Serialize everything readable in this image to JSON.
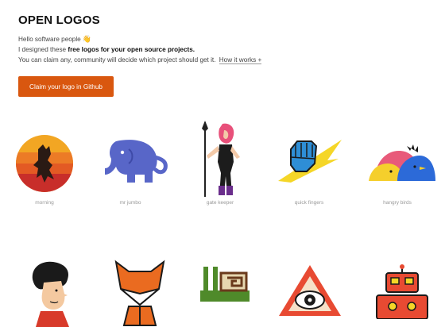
{
  "header": {
    "title": "OPEN LOGOS",
    "greeting": "Hello software people",
    "line2_pre": "I designed these ",
    "line2_bold": "free logos for your open source projects.",
    "line3": "You can claim any, community will decide which project should get it.",
    "how_link": "How it works +"
  },
  "cta": {
    "label": "Claim your logo in Github"
  },
  "logos": [
    {
      "name": "morning"
    },
    {
      "name": "mr jumbo"
    },
    {
      "name": "gate keeper"
    },
    {
      "name": "quick fingers"
    },
    {
      "name": "hangry birds"
    }
  ],
  "colors": {
    "accent": "#d9570f"
  }
}
